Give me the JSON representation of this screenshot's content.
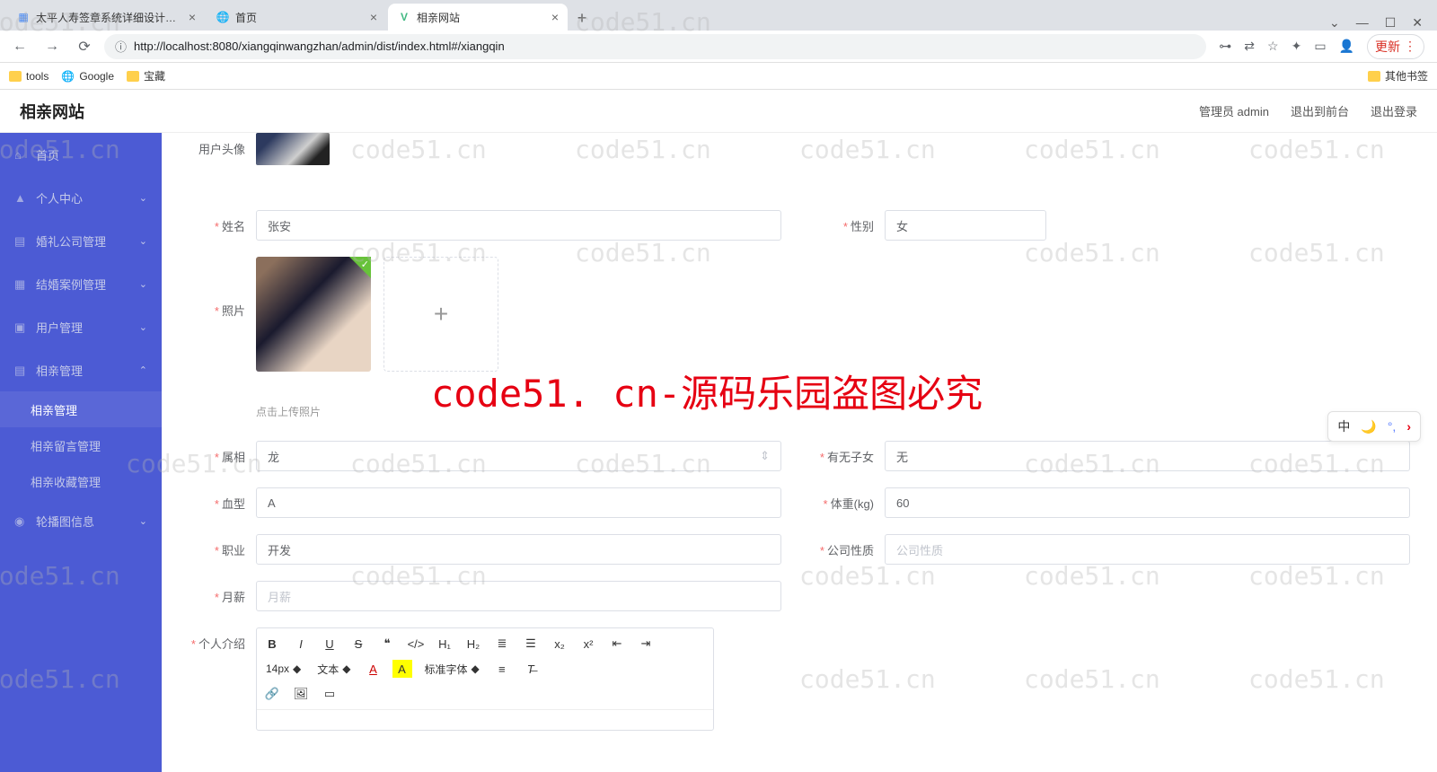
{
  "browser": {
    "tabs": [
      {
        "title": "太平人寿签章系统详细设计文档",
        "favicon": "📄"
      },
      {
        "title": "首页",
        "favicon": "🌐"
      },
      {
        "title": "相亲网站",
        "favicon": "V"
      }
    ],
    "url": "http://localhost:8080/xiangqinwangzhan/admin/dist/index.html#/xiangqin",
    "url_prefix": "ⓘ",
    "bookmarks": {
      "tools": "tools",
      "google": "Google",
      "treasure": "宝藏",
      "other": "其他书签"
    },
    "update_label": "更新",
    "window": {
      "min": "—",
      "max": "☐",
      "close": "✕",
      "down": "⌄"
    }
  },
  "header": {
    "app_title": "相亲网站",
    "admin_label": "管理员 admin",
    "exit_to_front": "退出到前台",
    "logout": "退出登录"
  },
  "sidebar": {
    "home": "首页",
    "personal": "个人中心",
    "wedding_company": "婚礼公司管理",
    "wedding_case": "结婚案例管理",
    "user_mgmt": "用户管理",
    "xiangqin_mgmt": "相亲管理",
    "xiangqin_sub1": "相亲管理",
    "xiangqin_sub2": "相亲留言管理",
    "xiangqin_sub3": "相亲收藏管理",
    "carousel": "轮播图信息"
  },
  "form": {
    "avatar_label": "用户头像",
    "name_label": "姓名",
    "name_value": "张安",
    "gender_label": "性别",
    "gender_value": "女",
    "photo_label": "照片",
    "photo_hint": "点击上传照片",
    "zodiac_label": "属相",
    "zodiac_value": "龙",
    "children_label": "有无子女",
    "children_value": "无",
    "blood_label": "血型",
    "blood_value": "A",
    "weight_label": "体重(kg)",
    "weight_value": "60",
    "job_label": "职业",
    "job_value": "开发",
    "company_label": "公司性质",
    "company_placeholder": "公司性质",
    "salary_label": "月薪",
    "salary_placeholder": "月薪",
    "intro_label": "个人介绍"
  },
  "editor": {
    "font_size": "14px",
    "font_type": "文本",
    "font_family": "标准字体"
  },
  "float_tools": {
    "cn": "中"
  },
  "watermark": {
    "text": "code51.cn",
    "red": "code51. cn-源码乐园盗图必究"
  }
}
